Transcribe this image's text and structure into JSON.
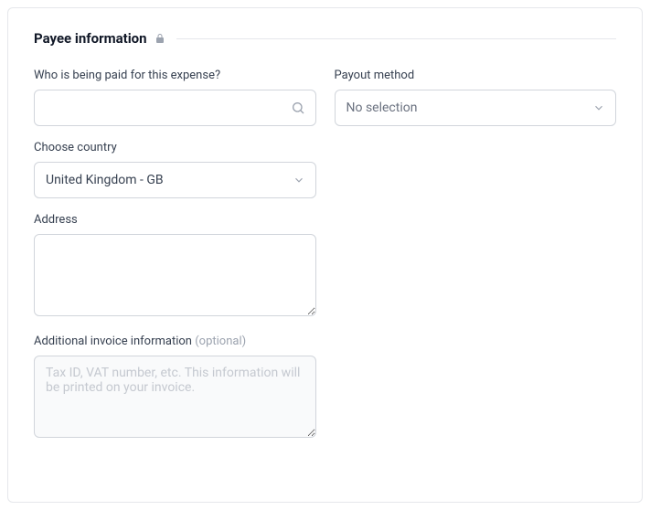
{
  "section": {
    "title": "Payee information"
  },
  "fields": {
    "payee": {
      "label": "Who is being paid for this expense?",
      "value": ""
    },
    "payout_method": {
      "label": "Payout method",
      "selected": "No selection"
    },
    "country": {
      "label": "Choose country",
      "selected": "United Kingdom - GB"
    },
    "address": {
      "label": "Address",
      "value": ""
    },
    "additional_info": {
      "label": "Additional invoice information",
      "optional_text": "(optional)",
      "placeholder": "Tax ID, VAT number, etc. This information will be printed on your invoice.",
      "value": ""
    }
  }
}
